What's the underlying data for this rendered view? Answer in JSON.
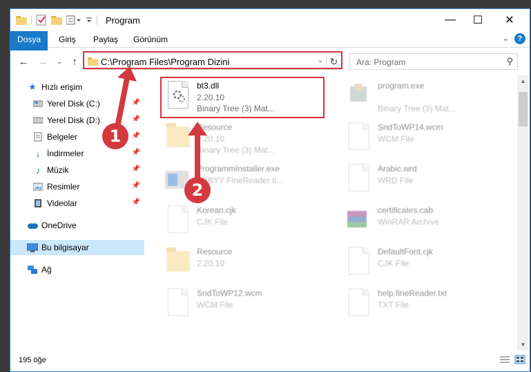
{
  "window": {
    "title": "Program",
    "controls": {
      "minimize": "—",
      "maximize": "☐",
      "close": "✕"
    }
  },
  "ribbon": {
    "tabs": [
      "Dosya",
      "Giriş",
      "Paylaş",
      "Görünüm"
    ]
  },
  "address": {
    "path": "C:\\Program Files\\Program Dizini"
  },
  "search": {
    "placeholder": "Ara: Program"
  },
  "sidebar": {
    "items": [
      {
        "label": "Hızlı erişim",
        "icon": "star-icon"
      },
      {
        "label": "Yerel Disk (C:)",
        "icon": "drive-icon"
      },
      {
        "label": "Yerel Disk (D:)",
        "icon": "drive-icon"
      },
      {
        "label": "Belgeler",
        "icon": "documents-icon"
      },
      {
        "label": "İndirmeler",
        "icon": "download-icon"
      },
      {
        "label": "Müzik",
        "icon": "music-icon"
      },
      {
        "label": "Resimler",
        "icon": "pictures-icon"
      },
      {
        "label": "Videolar",
        "icon": "video-icon"
      },
      {
        "label": "OneDrive",
        "icon": "cloud-icon"
      },
      {
        "label": "Bu bilgisayar",
        "icon": "computer-icon"
      },
      {
        "label": "Ağ",
        "icon": "network-icon"
      }
    ]
  },
  "files": [
    {
      "name": "bt3.dll",
      "line2": "2.20.10",
      "line3": "Binary Tree (3) Mat...",
      "icon": "dll-icon"
    },
    {
      "name": "program.exe",
      "line2": "Binary Tree (3) Mat...",
      "line3": "",
      "icon": "exe-icon"
    },
    {
      "name": "Resource",
      "line2": "2.20.10",
      "line3": "Binary Tree (3) Mat...",
      "icon": "folder-icon"
    },
    {
      "name": "SndToWP14.wcm",
      "line2": "WCM File",
      "line3": "",
      "icon": "file-icon"
    },
    {
      "name": "ProgrammInstaller.exe",
      "line2": "ABBYY FineReader ti...",
      "line3": "",
      "icon": "installer-icon"
    },
    {
      "name": "Arabic.wrd",
      "line2": "WRD File",
      "line3": "",
      "icon": "file-icon"
    },
    {
      "name": "Korean.cjk",
      "line2": "CJK File",
      "line3": "",
      "icon": "file-icon"
    },
    {
      "name": "certificates.cab",
      "line2": "WinRAR Archive",
      "line3": "",
      "icon": "winrar-icon"
    },
    {
      "name": "Resource",
      "line2": "2.20.10",
      "line3": "",
      "icon": "folder-icon"
    },
    {
      "name": "DefaultFont.cjk",
      "line2": "CJK File",
      "line3": "",
      "icon": "file-icon"
    },
    {
      "name": "SndToWP12.wcm",
      "line2": "WCM File",
      "line3": "",
      "icon": "file-icon"
    },
    {
      "name": "help.fineReader.txt",
      "line2": "TXT File",
      "line3": "",
      "icon": "file-icon"
    }
  ],
  "status": {
    "count": "195 öğe"
  },
  "annotations": {
    "marker1": "1",
    "marker2": "2",
    "color": "#d23a40"
  }
}
